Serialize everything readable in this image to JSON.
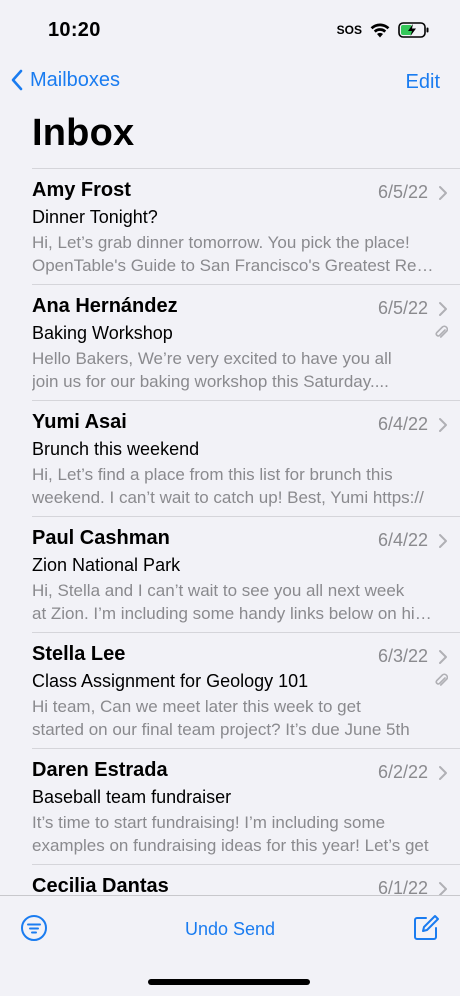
{
  "status": {
    "time": "10:20",
    "sos": "SOS"
  },
  "nav": {
    "back_label": "Mailboxes",
    "edit_label": "Edit"
  },
  "title": "Inbox",
  "messages": [
    {
      "sender": "Amy Frost",
      "date": "6/5/22",
      "subject": "Dinner Tonight?",
      "preview_1": "Hi, Let’s grab dinner tomorrow. You pick the place!",
      "preview_2": "OpenTable's Guide to San Francisco's Greatest Restaurants",
      "attachment": false
    },
    {
      "sender": "Ana Hernández",
      "date": "6/5/22",
      "subject": "Baking Workshop",
      "preview_1": "Hello Bakers, We’re very excited to have you all",
      "preview_2": "join us for our baking workshop this Saturday....",
      "attachment": true
    },
    {
      "sender": "Yumi Asai",
      "date": "6/4/22",
      "subject": "Brunch this weekend",
      "preview_1": "Hi, Let’s find a place from this list for brunch this",
      "preview_2": "weekend. I can’t wait to catch up! Best, Yumi https://",
      "attachment": false
    },
    {
      "sender": "Paul Cashman",
      "date": "6/4/22",
      "subject": "Zion National Park",
      "preview_1": "Hi, Stella and I can’t wait to see you all next week",
      "preview_2": "at Zion. I’m including some handy links below on hikes",
      "attachment": false
    },
    {
      "sender": "Stella Lee",
      "date": "6/3/22",
      "subject": "Class Assignment for Geology 101",
      "preview_1": "Hi team, Can we meet later this week to get",
      "preview_2": "started on our final team project? It’s due June 5th",
      "attachment": true
    },
    {
      "sender": "Daren Estrada",
      "date": "6/2/22",
      "subject": "Baseball team fundraiser",
      "preview_1": "It’s time to start fundraising! I’m including some",
      "preview_2": "examples on fundraising ideas for this year! Let’s get",
      "attachment": false
    },
    {
      "sender": "Cecilia Dantas",
      "date": "6/1/22",
      "subject": "",
      "preview_1": "",
      "preview_2": "",
      "attachment": false
    }
  ],
  "toolbar": {
    "undo_label": "Undo Send"
  },
  "colors": {
    "accent": "#1a7cf0",
    "secondary_text": "#8a8a8e",
    "background": "#f2f2f7"
  }
}
